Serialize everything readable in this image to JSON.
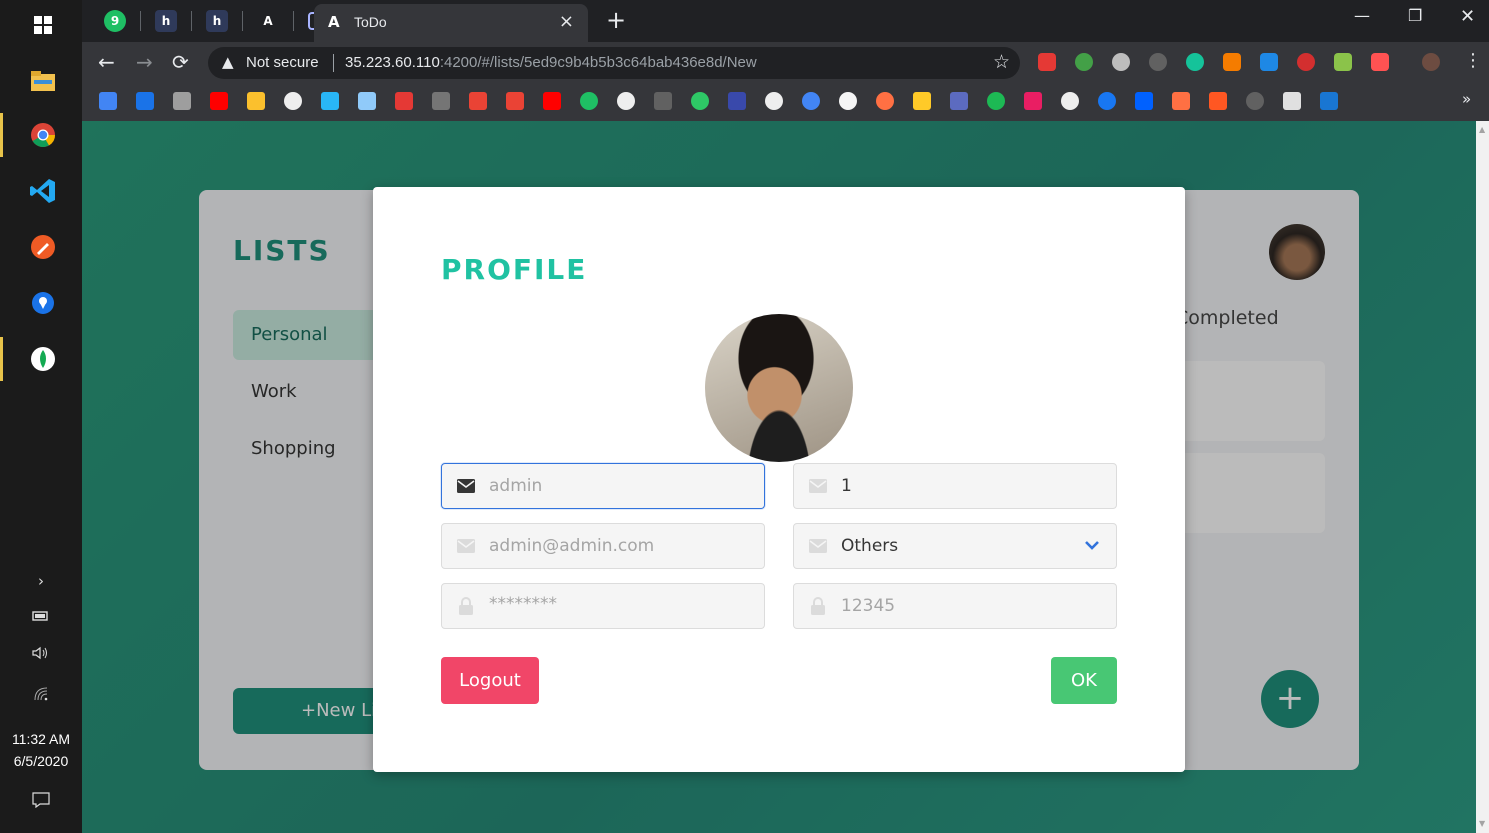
{
  "taskbar": {
    "time": "11:32 AM",
    "date": "6/5/2020"
  },
  "browser": {
    "tab_title": "ToDo",
    "security_label": "Not secure",
    "url_host": "35.223.60.110",
    "url_path": ":4200/#/lists/5ed9c9b4b5b3c64bab436e8d/New",
    "bookmarks_overflow": "»"
  },
  "app": {
    "lists_title": "LISTS",
    "lists": [
      {
        "label": "Personal"
      },
      {
        "label": "Work"
      },
      {
        "label": "Shopping"
      }
    ],
    "new_list_label": "+New List",
    "completed_label": "Completed"
  },
  "profile": {
    "title": "PROFILE",
    "username_placeholder": "admin",
    "id_value": "1",
    "email_placeholder": "admin@admin.com",
    "gender_value": "Others",
    "password_placeholder": "********",
    "pin_value": "12345",
    "logout_label": "Logout",
    "ok_label": "OK"
  },
  "colors": {
    "accent": "#20c2a2",
    "brand": "#1c8f7b",
    "danger": "#f14668",
    "success": "#48c774",
    "focus": "#3273dc"
  }
}
